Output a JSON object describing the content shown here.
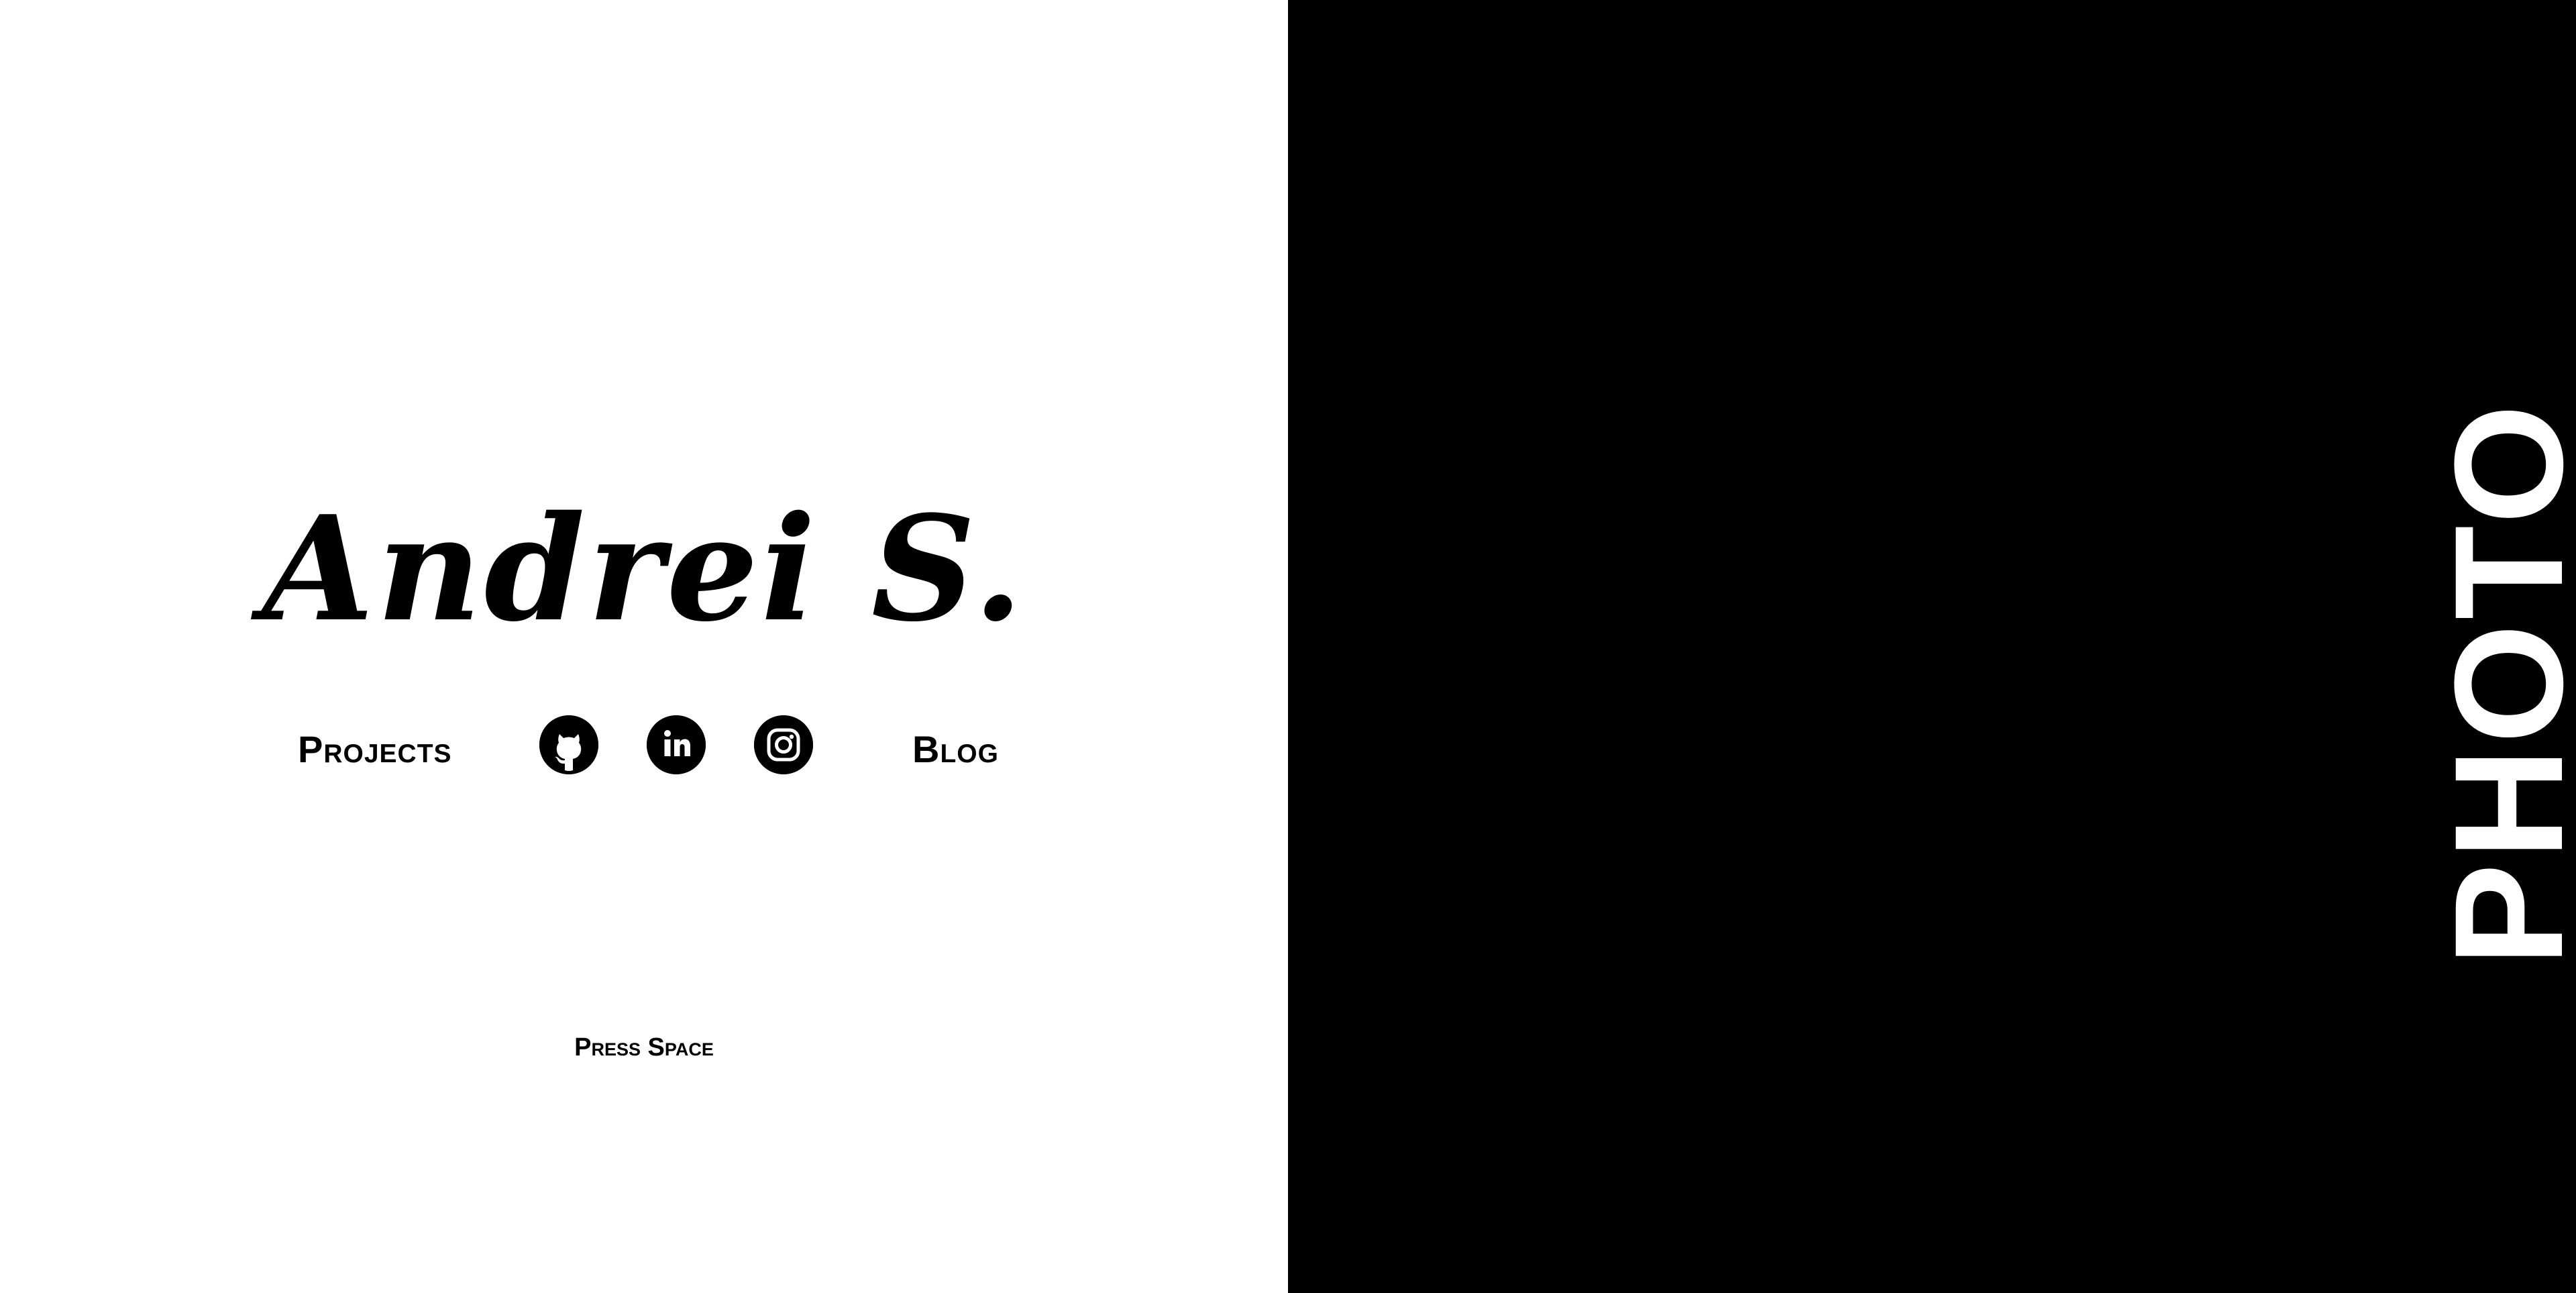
{
  "hero": {
    "name": "Andrei S."
  },
  "nav": {
    "projects_label": "Projects",
    "blog_label": "Blog",
    "social": [
      {
        "icon": "github-icon"
      },
      {
        "icon": "linkedin-icon"
      },
      {
        "icon": "instagram-icon"
      }
    ]
  },
  "hint": {
    "press_space": "Press Space"
  },
  "side_panel": {
    "label": "PHOTO"
  },
  "colors": {
    "left_background": "#ffffff",
    "right_background": "#000000",
    "text": "#000000",
    "inverse_text": "#ffffff"
  }
}
